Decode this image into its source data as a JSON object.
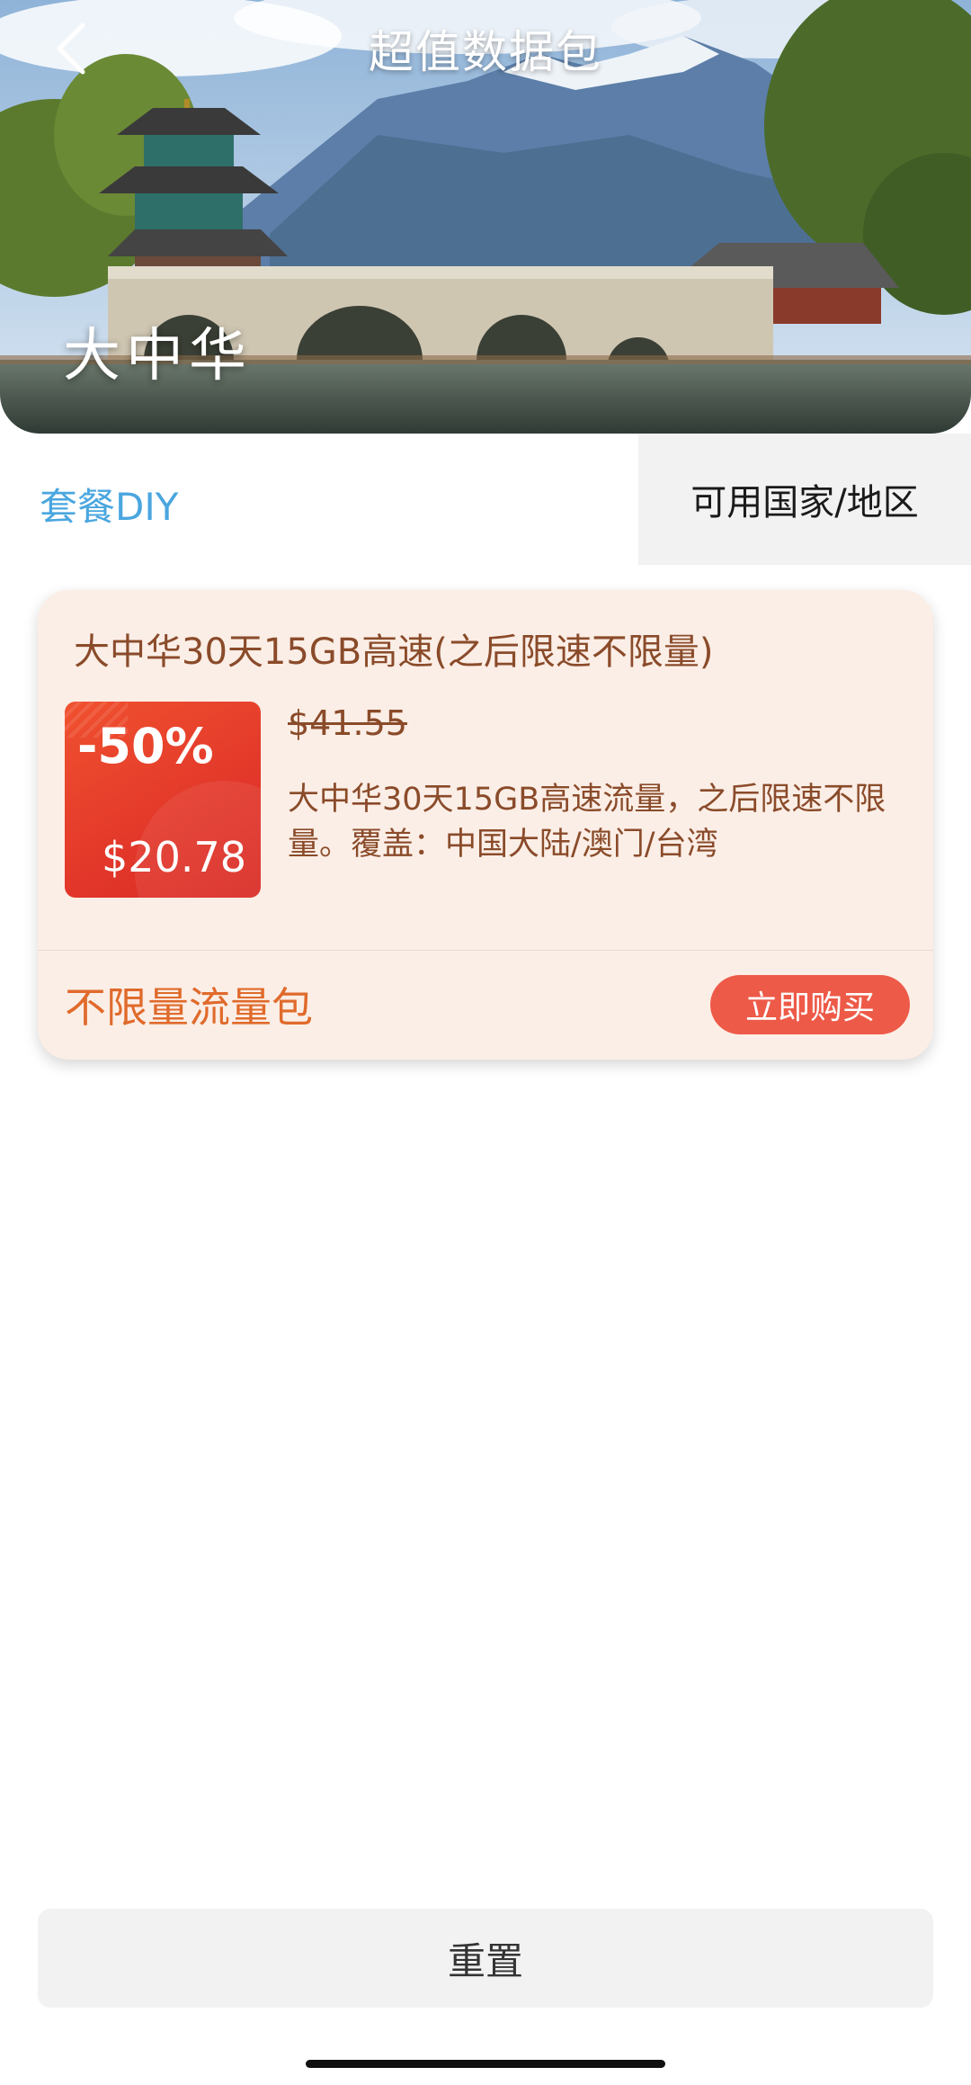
{
  "header": {
    "title": "超值数据包",
    "back_icon": "chevron-left-icon"
  },
  "hero": {
    "region_name": "大中华"
  },
  "tabs": {
    "diy_label": "套餐DIY",
    "countries_label": "可用国家/地区"
  },
  "package_card": {
    "title": "大中华30天15GB高速(之后限速不限量)",
    "discount": "-50%",
    "price": "$20.78",
    "original_price": "$41.55",
    "description": "大中华30天15GB高速流量，之后限速不限量。覆盖：中国大陆/澳门/台湾",
    "package_type": "不限量流量包",
    "buy_label": "立即购买"
  },
  "footer": {
    "reset_label": "重置"
  },
  "colors": {
    "accent_blue": "#4aa6df",
    "card_bg": "#fbeee6",
    "card_text": "#8a4b2a",
    "discount_red": "#e2372a",
    "package_orange": "#e06a2b",
    "buy_button": "#ee5a48"
  }
}
